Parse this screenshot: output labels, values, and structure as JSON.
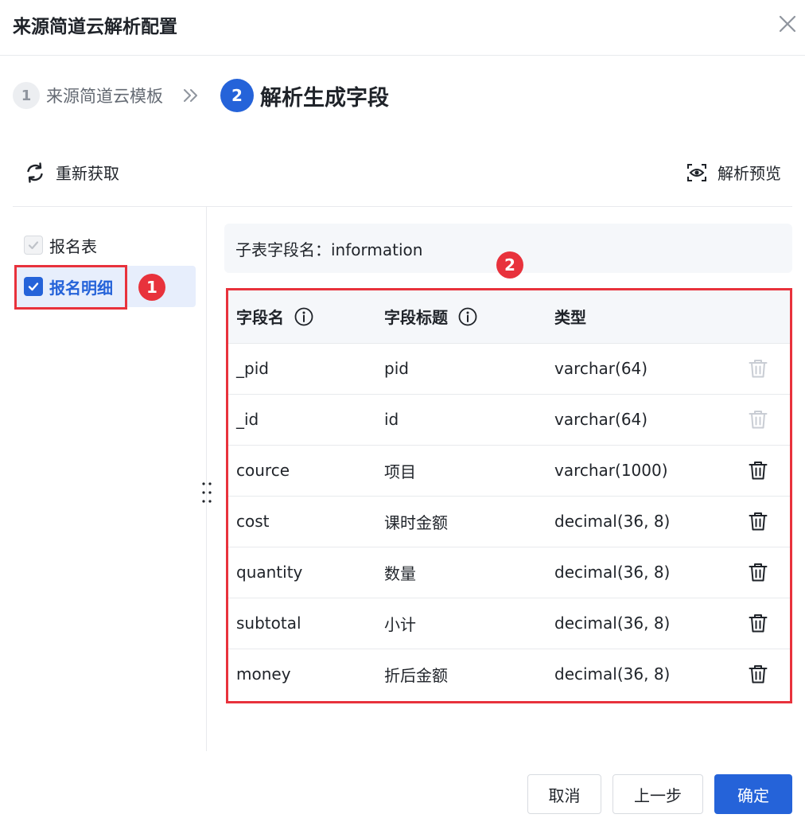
{
  "dialog": {
    "title": "来源简道云解析配置"
  },
  "steps": [
    {
      "number": "1",
      "label": "来源简道云模板",
      "state": "inactive"
    },
    {
      "number": "2",
      "label": "解析生成字段",
      "state": "active"
    }
  ],
  "toolbar": {
    "refresh_label": "重新获取",
    "preview_label": "解析预览"
  },
  "sidebar": {
    "items": [
      {
        "label": "报名表",
        "checked": true,
        "disabled": true
      },
      {
        "label": "报名明细",
        "checked": true,
        "selected": true
      }
    ]
  },
  "annotations": {
    "callout_1": "1",
    "callout_2": "2"
  },
  "subtable": {
    "name_text": "子表字段名：information"
  },
  "table": {
    "headers": {
      "name": "字段名",
      "title": "字段标题",
      "type": "类型"
    },
    "rows": [
      {
        "name": "_pid",
        "title": "pid",
        "type": "varchar(64)",
        "deletable": false
      },
      {
        "name": "_id",
        "title": "id",
        "type": "varchar(64)",
        "deletable": false
      },
      {
        "name": "cource",
        "title": "项目",
        "type": "varchar(1000)",
        "deletable": true
      },
      {
        "name": "cost",
        "title": "课时金额",
        "type": "decimal(36, 8)",
        "deletable": true
      },
      {
        "name": "quantity",
        "title": "数量",
        "type": "decimal(36, 8)",
        "deletable": true
      },
      {
        "name": "subtotal",
        "title": "小计",
        "type": "decimal(36, 8)",
        "deletable": true
      },
      {
        "name": "money",
        "title": "折后金额",
        "type": "decimal(36, 8)",
        "deletable": true
      }
    ]
  },
  "footer": {
    "cancel_label": "取消",
    "prev_label": "上一步",
    "ok_label": "确定"
  },
  "colors": {
    "primary": "#2563d9",
    "annotation_red": "#e8323c",
    "disabled_icon": "#c9cdd4"
  },
  "icons": {
    "close": "close-icon",
    "step_arrow": "double-chevron-right-icon",
    "refresh": "refresh-icon",
    "preview": "eye-scan-icon",
    "info": "info-icon",
    "trash": "trash-icon",
    "check": "check-icon",
    "resize": "drag-handle-icon"
  }
}
